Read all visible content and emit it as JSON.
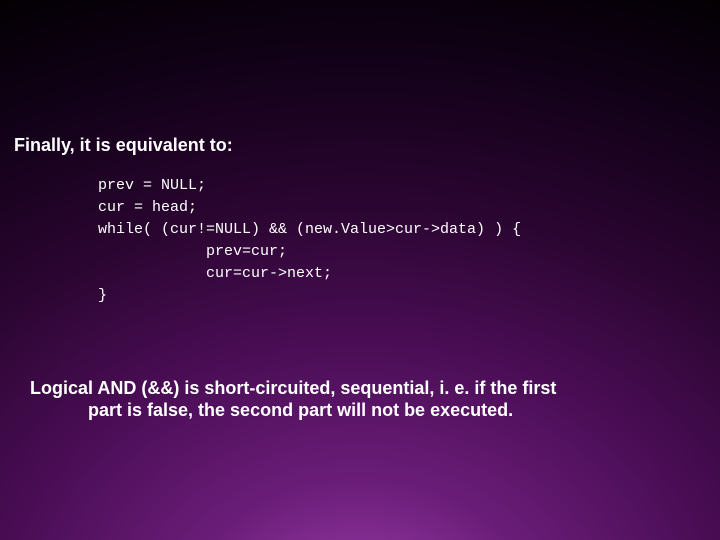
{
  "heading": "Finally, it is equivalent to:",
  "code": {
    "l1": "prev = NULL;",
    "l2": "cur = head;",
    "l3": "while( (cur!=NULL) && (new.Value>cur->data) ) {",
    "l4": "            prev=cur;",
    "l5": "            cur=cur->next;",
    "l6": "}"
  },
  "conclusion_line1": "Logical AND (&&) is short-circuited, sequential, i. e. if the first",
  "conclusion_line2": "part is false, the second part will not be executed."
}
